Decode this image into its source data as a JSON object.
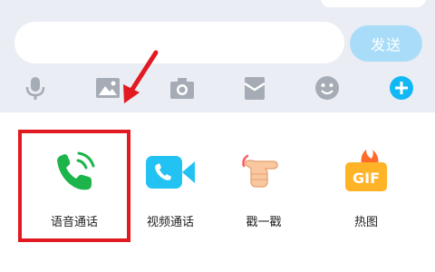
{
  "composer": {
    "send_label": "发送"
  },
  "toolbar": {
    "icons": [
      "microphone-icon",
      "picture-icon",
      "camera-icon",
      "red-packet-icon",
      "emoji-icon",
      "plus-icon"
    ]
  },
  "panel": {
    "items": [
      {
        "label": "语音通话",
        "icon": "phone-icon"
      },
      {
        "label": "视频通话",
        "icon": "video-call-icon"
      },
      {
        "label": "戳一戳",
        "icon": "poke-hand-icon"
      },
      {
        "label": "热图",
        "icon": "gif-icon"
      }
    ]
  },
  "colors": {
    "accent": "#12b7f5",
    "send_button": "#a9dcf8",
    "annotation": "#e11a22",
    "voice_call": "#1db44b",
    "toolbar_icon": "#a6acb5"
  }
}
